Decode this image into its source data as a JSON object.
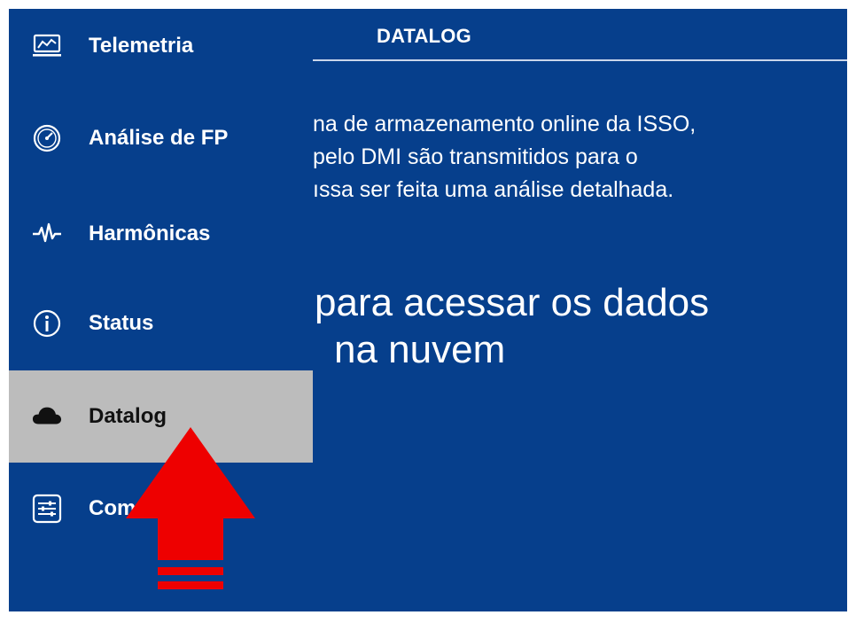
{
  "main": {
    "title": "DATALOG",
    "description_lines": [
      "na de armazenamento online da ISSO,",
      " pelo  DMI  são  transmitidos  para  o",
      "ıssa ser feita uma análise detalhada."
    ],
    "cta_lines": [
      "para acessar os dados",
      "na nuvem"
    ]
  },
  "sidebar": {
    "items": [
      {
        "label": "Telemetria",
        "icon": "telemetry-icon"
      },
      {
        "label": "Análise de FP",
        "icon": "gauge-icon"
      },
      {
        "label": "Harmônicas",
        "icon": "waveform-icon"
      },
      {
        "label": "Status",
        "icon": "info-icon"
      },
      {
        "label": "Datalog",
        "icon": "cloud-icon",
        "active": true
      },
      {
        "label": "Configuração",
        "icon": "sliders-icon",
        "visible_text": "Com      ção"
      }
    ]
  },
  "colors": {
    "background": "#063f8c",
    "active_item": "#bcbcbc",
    "annotation_arrow": "#ee0000"
  }
}
